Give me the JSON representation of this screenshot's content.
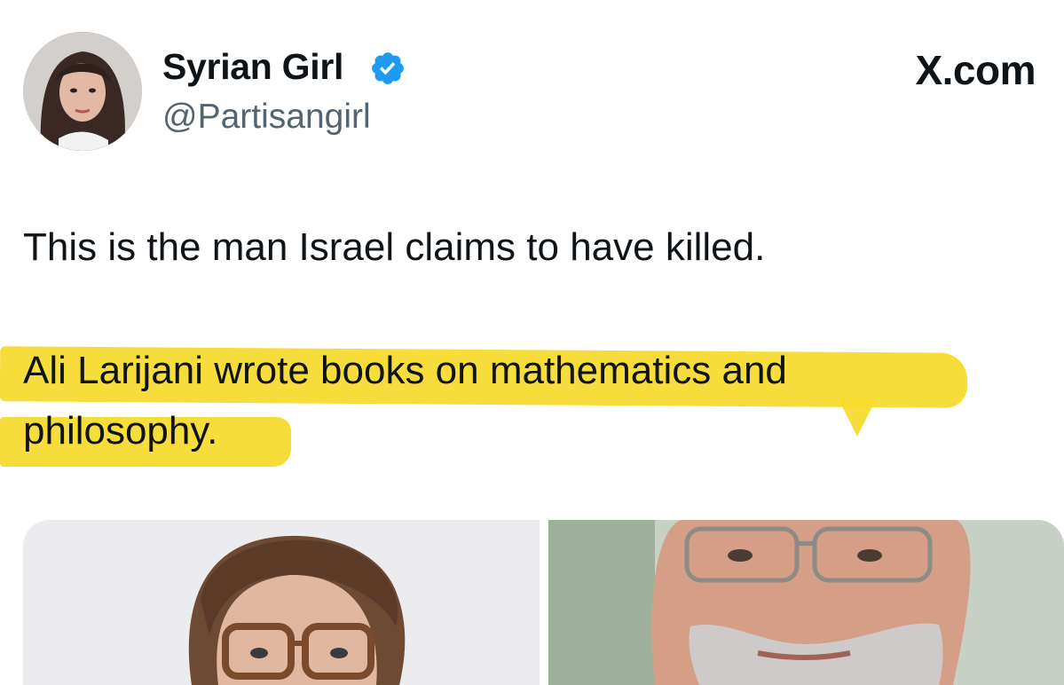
{
  "author": {
    "display_name": "Syrian Girl",
    "handle": "@Partisangirl",
    "verified": true,
    "verified_color": "#1d9bf0"
  },
  "site_label": "X.com",
  "post": {
    "line1": "This is the man Israel claims to have killed.",
    "highlighted_line1": "Ali Larijani  wrote books on mathematics and",
    "highlighted_line2": "philosophy.",
    "highlight_color": "#f6da2b"
  },
  "media": [
    {
      "kind": "photo",
      "icon": "photo-man-glasses-curly-hair"
    },
    {
      "kind": "photo",
      "icon": "photo-older-man-glasses-beard"
    }
  ]
}
